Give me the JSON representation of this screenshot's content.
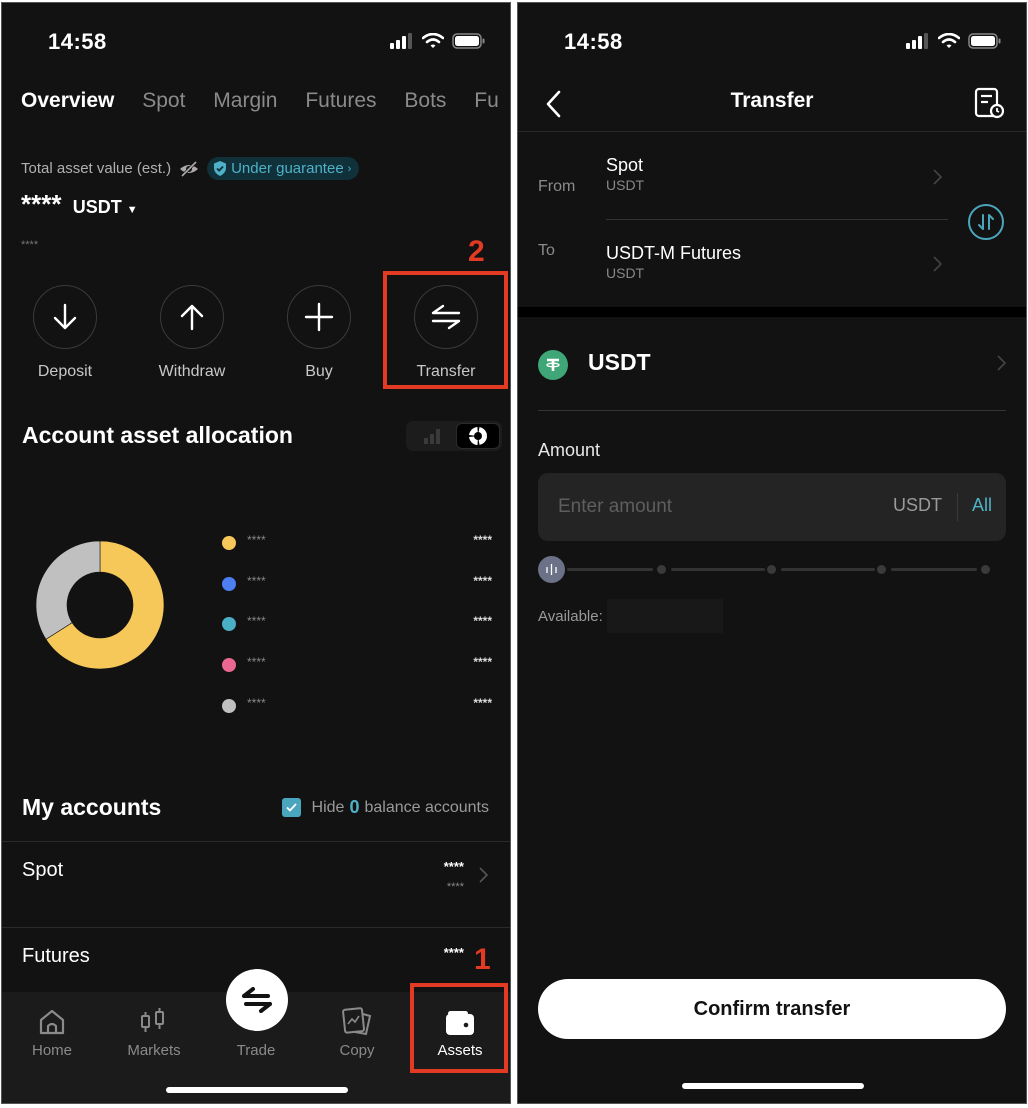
{
  "left": {
    "status_time": "14:58",
    "tabs": [
      "Overview",
      "Spot",
      "Margin",
      "Futures",
      "Bots",
      "Fu"
    ],
    "active_tab": 0,
    "total_label": "Total asset value (est.)",
    "guarantee_label": "Under guarantee",
    "total_value": "****",
    "currency": "USDT",
    "sub_value": "****",
    "actions": [
      {
        "label": "Deposit",
        "icon": "arrow-down-icon"
      },
      {
        "label": "Withdraw",
        "icon": "arrow-up-icon"
      },
      {
        "label": "Buy",
        "icon": "plus-icon"
      },
      {
        "label": "Transfer",
        "icon": "transfer-icon"
      }
    ],
    "allocation_title": "Account asset allocation",
    "legend": [
      {
        "name": "****",
        "value": "****",
        "color": "#f6c85a"
      },
      {
        "name": "****",
        "value": "****",
        "color": "#4d7ff2"
      },
      {
        "name": "****",
        "value": "****",
        "color": "#4ab0c5"
      },
      {
        "name": "****",
        "value": "****",
        "color": "#e96790"
      },
      {
        "name": "****",
        "value": "****",
        "color": "#c0c0c0"
      }
    ],
    "my_accounts_title": "My accounts",
    "hide_prefix": "Hide",
    "hide_zero": "0",
    "hide_suffix": "balance accounts",
    "hide_checked": true,
    "accounts": [
      {
        "name": "Spot",
        "value": "****",
        "sub": "****"
      },
      {
        "name": "Futures",
        "value": "****",
        "sub": ""
      }
    ],
    "bottom_tabs": [
      {
        "label": "Home",
        "icon": "home-icon"
      },
      {
        "label": "Markets",
        "icon": "markets-icon"
      },
      {
        "label": "Trade",
        "icon": "trade-icon"
      },
      {
        "label": "Copy",
        "icon": "copy-trading-icon"
      },
      {
        "label": "Assets",
        "icon": "wallet-icon"
      }
    ],
    "active_bottom_tab": 4,
    "annotations": {
      "step1": "1",
      "step2": "2"
    }
  },
  "right": {
    "status_time": "14:58",
    "title": "Transfer",
    "from_label": "From",
    "from_account": "Spot",
    "from_currency": "USDT",
    "to_label": "To",
    "to_account": "USDT-M Futures",
    "to_currency": "USDT",
    "coin": "USDT",
    "amount_label": "Amount",
    "amount_placeholder": "Enter amount",
    "amount_value": "",
    "amount_unit": "USDT",
    "all_label": "All",
    "slider_percent": 0,
    "available_label": "Available:",
    "confirm_label": "Confirm transfer"
  },
  "colors": {
    "accent": "#4fb1c7",
    "annotation": "#e23a23",
    "background": "#121212"
  },
  "chart_data": {
    "type": "pie",
    "title": "Account asset allocation",
    "categories": [
      "****",
      "****",
      "****",
      "****",
      "****"
    ],
    "values": [
      66,
      0,
      0,
      0,
      34
    ],
    "colors": [
      "#f6c85a",
      "#4d7ff2",
      "#4ab0c5",
      "#e96790",
      "#c0c0c0"
    ],
    "donut": true,
    "legend": "right"
  }
}
